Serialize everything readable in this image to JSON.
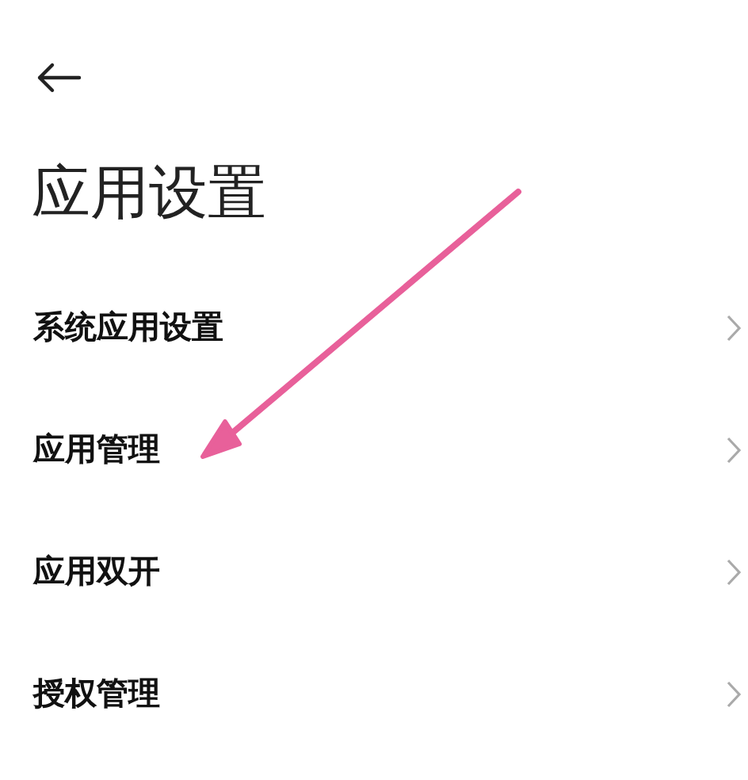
{
  "header": {
    "title": "应用设置"
  },
  "items": [
    {
      "label": "系统应用设置"
    },
    {
      "label": "应用管理"
    },
    {
      "label": "应用双开"
    },
    {
      "label": "授权管理"
    }
  ]
}
